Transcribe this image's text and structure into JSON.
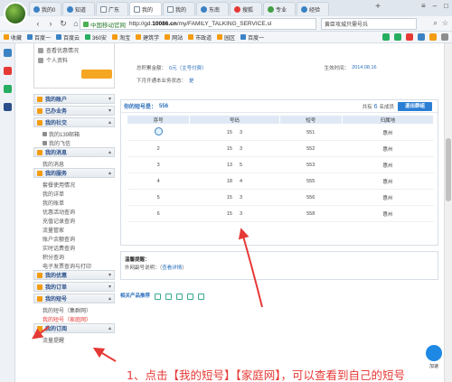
{
  "browser": {
    "tabs": [
      {
        "label": "我的0",
        "active": false
      },
      {
        "label": "知道",
        "active": false
      },
      {
        "label": "广东",
        "active": false
      },
      {
        "label": "我的",
        "active": true
      },
      {
        "label": "我的",
        "active": false
      },
      {
        "label": "东南",
        "active": false
      },
      {
        "label": "搜狐",
        "active": false
      },
      {
        "label": "专业",
        "active": false
      },
      {
        "label": "经验",
        "active": false
      }
    ],
    "new_tab": "+",
    "address": {
      "site_label": "中国移动官网",
      "url_prefix": "http://gd.",
      "url_domain": "10086.cn",
      "url_suffix": "/my/FAMILY_TALKING_SERVICE.sl"
    },
    "search_text": "黄臣攻城只需号兵",
    "bookmarks": [
      "收藏",
      "百度一",
      "百度云",
      "360安",
      "淘宝",
      "建筑学",
      "网站",
      "市政道",
      "园区",
      "百度一"
    ]
  },
  "sidebar": {
    "top_items": [
      "查看优惠情况",
      "个人资料"
    ],
    "yellow_button": "",
    "sections": [
      {
        "title": "我的账户",
        "items": []
      },
      {
        "title": "已办业务",
        "items": []
      },
      {
        "title": "我的社交",
        "items": [
          "我的139邮箱",
          "我的飞信"
        ]
      },
      {
        "title": "我的消息",
        "items": [
          "我的消息"
        ]
      },
      {
        "title": "我的服务",
        "items": [
          "套餐使用情况",
          "我的详单",
          "我的账单",
          "优惠活动查询",
          "充值记录查询",
          "流量管家",
          "账户余额查询",
          "实时话费查询",
          "积分查询",
          "电子发票查询与打印"
        ]
      },
      {
        "title": "我的优惠",
        "items": []
      },
      {
        "title": "我的订单",
        "items": []
      },
      {
        "title": "我的短号",
        "items": [
          "我的短号（集群网）",
          "我的短号（家庭网）"
        ]
      },
      {
        "title": "我的订阅",
        "items": [
          "流量提醒"
        ]
      }
    ]
  },
  "main": {
    "info": {
      "max_members_label": "总积累金额：",
      "max_members_value": "0元（主号付费）",
      "effective_label": "生效时间：",
      "effective_value": "2014.08.16",
      "next_month_label": "下月开通本业务状态：",
      "next_month_value": "是"
    },
    "panel": {
      "title_prefix": "你的短号是：",
      "short_number": "556",
      "members_prefix": "共有",
      "members_count": "6",
      "members_suffix": "名成员",
      "exit_button": "退出群组",
      "columns": [
        "序号",
        "号码",
        "短号",
        "归属地"
      ],
      "rows": [
        {
          "index": "",
          "icon": true,
          "number_a": "15",
          "number_b": "3",
          "short": "551",
          "region": "惠州"
        },
        {
          "index": "2",
          "icon": false,
          "number_a": "15",
          "number_b": "3",
          "short": "552",
          "region": "惠州"
        },
        {
          "index": "3",
          "icon": false,
          "number_a": "13",
          "number_b": "5",
          "short": "553",
          "region": "惠州"
        },
        {
          "index": "4",
          "icon": false,
          "number_a": "18",
          "number_b": "4",
          "short": "555",
          "region": "惠州"
        },
        {
          "index": "5",
          "icon": false,
          "number_a": "15",
          "number_b": "3",
          "short": "556",
          "region": "惠州"
        },
        {
          "index": "6",
          "icon": false,
          "number_a": "15",
          "number_b": "3",
          "short": "558",
          "region": "惠州"
        }
      ]
    },
    "notice": {
      "title": "温馨提醒：",
      "text_prefix": "外网副号说明：（",
      "link": "查看详情",
      "text_suffix": "）"
    },
    "related_title": "相关产品推荐"
  },
  "caption": "1、点击【我的短号】【家庭网】，可以查看到自己的短号",
  "float_widget": {
    "label": "加速"
  },
  "colors": {
    "accent": "#2a7fd4",
    "annotation": "#e53935",
    "header_bg": "#dfe9f6",
    "orange": "#f5a623"
  }
}
